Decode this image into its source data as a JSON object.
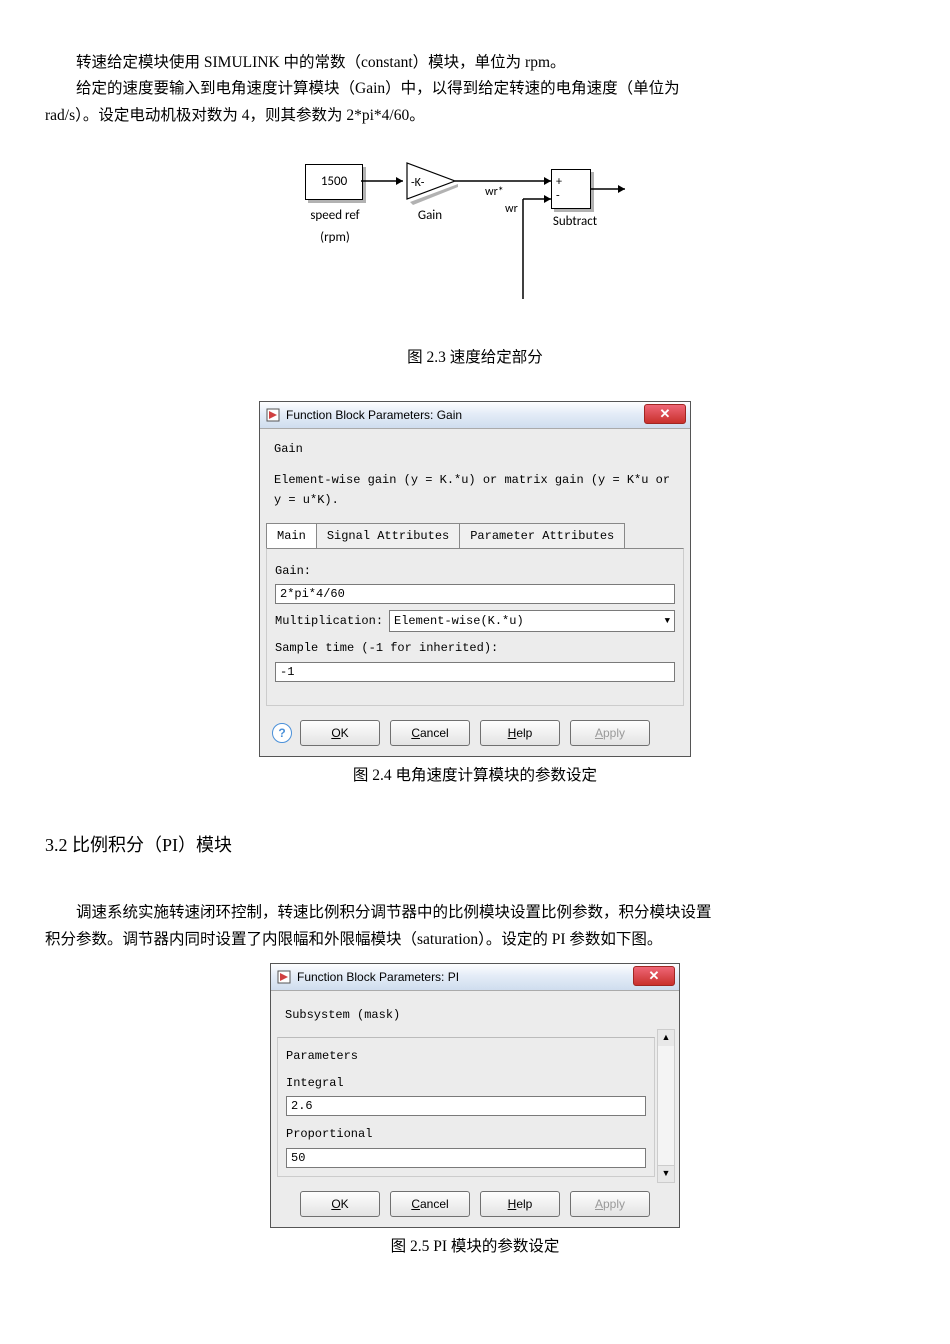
{
  "text": {
    "p1": "转速给定模块使用 SIMULINK 中的常数（constant）模块，单位为 rpm。",
    "p2a": "给定的速度要输入到电角速度计算模块（Gain）中，以得到给定转速的电角速度（单位为",
    "p2b": "rad/s）。设定电动机极对数为 4，则其参数为 2*pi*4/60。",
    "cap23": "图 2.3 速度给定部分",
    "cap24": "图 2.4 电角速度计算模块的参数设定",
    "section32": "3.2 比例积分（PI）模块",
    "p3a": "调速系统实施转速闭环控制，转速比例积分调节器中的比例模块设置比例参数，积分模块设置",
    "p3b": "积分参数。调节器内同时设置了内限幅和外限幅模块（saturation）。设定的 PI 参数如下图。",
    "cap25": "图 2.5 PI 模块的参数设定"
  },
  "diagram": {
    "const_val": "1500",
    "const_label_l1": "speed ref",
    "const_label_l2": "(rpm)",
    "gain_text": "-K-",
    "gain_label": "Gain",
    "sig1": "wr*",
    "sig2": "wr",
    "sum_plus": "+",
    "sum_minus": "-",
    "sum_label": "Subtract"
  },
  "dlg_gain": {
    "title": "Function Block Parameters: Gain",
    "subtitle": "Gain",
    "desc": "Element-wise gain (y = K.*u) or matrix gain (y = K*u or y = u*K).",
    "tab1": "Main",
    "tab2": "Signal Attributes",
    "tab3": "Parameter Attributes",
    "gain_label": "Gain:",
    "gain_val": "2*pi*4/60",
    "mult_label": "Multiplication:",
    "mult_val": "Element-wise(K.*u)",
    "st_label": "Sample time (-1 for inherited):",
    "st_val": "-1"
  },
  "dlg_pi": {
    "title": "Function Block Parameters: PI",
    "mask": "Subsystem (mask)",
    "params": "Parameters",
    "integral_lbl": "Integral",
    "integral_val": "2.6",
    "prop_lbl": "Proportional",
    "prop_val": "50"
  },
  "buttons": {
    "ok_u": "O",
    "ok_r": "K",
    "cancel_u": "C",
    "cancel_r": "ancel",
    "help_u": "H",
    "help_r": "elp",
    "apply_u": "A",
    "apply_r": "pply"
  }
}
